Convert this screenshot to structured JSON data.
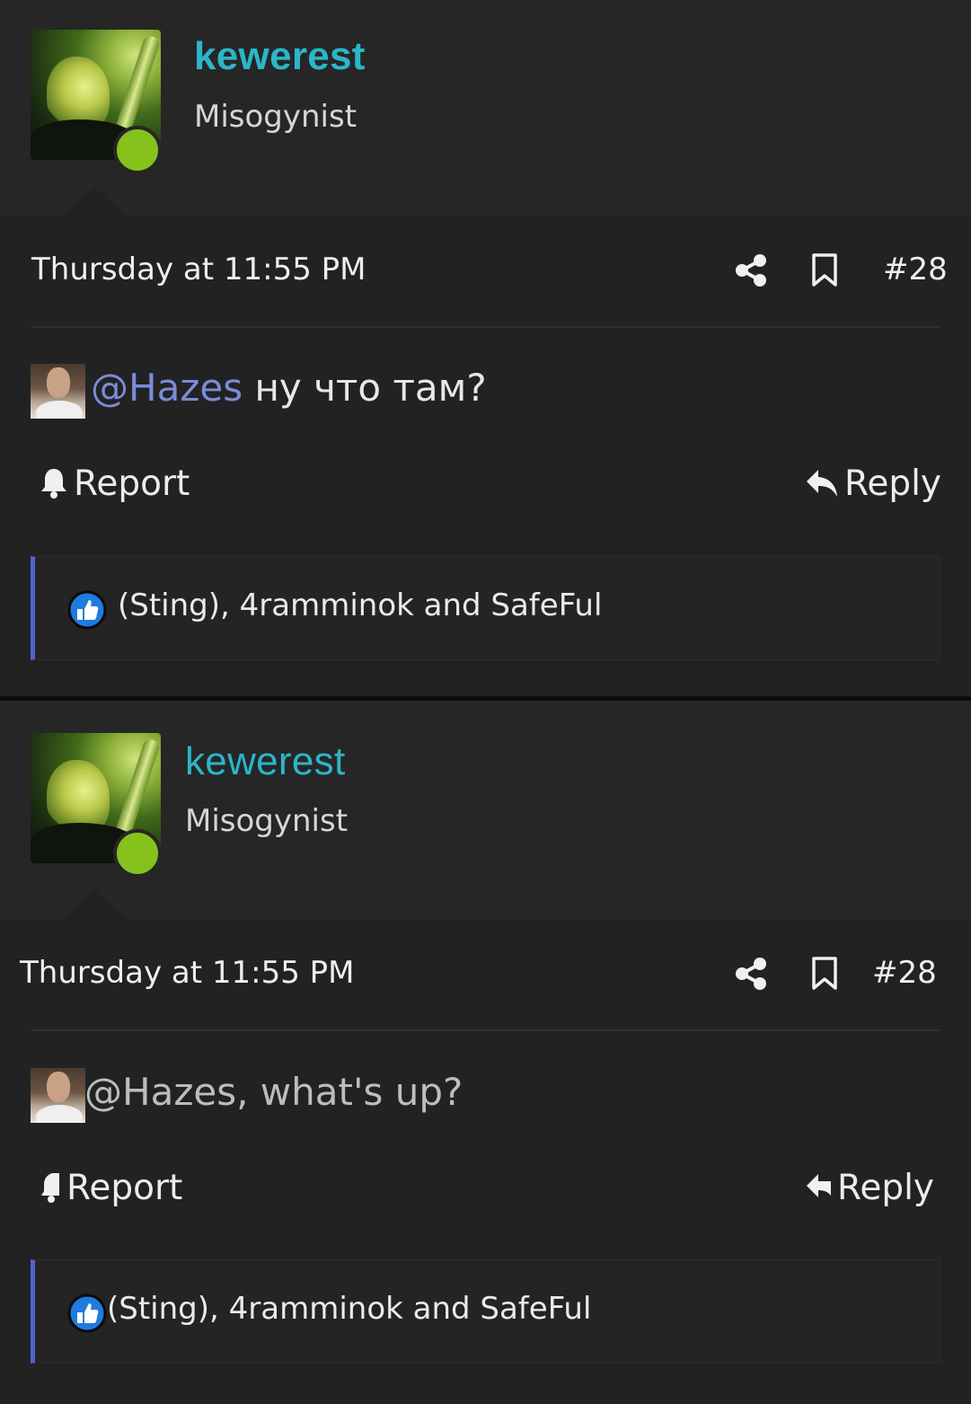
{
  "posts": [
    {
      "username": "kewerest",
      "user_title": "Misogynist",
      "date": "Thursday at 11:55 PM",
      "post_number": "#28",
      "mention": "@Hazes",
      "message_rest": " ну что там?",
      "report_label": "Report",
      "reply_label": "Reply",
      "reactions_text": "(Sting), 4ramminok and SafeFul"
    },
    {
      "username": "kewerest",
      "user_title": "Misogynist",
      "date": "Thursday at 11:55 PM",
      "post_number": "#28",
      "mention": "@Hazes",
      "message_rest": ", what's up?",
      "report_label": "Report",
      "reply_label": "Reply",
      "reactions_text": "(Sting), 4ramminok and SafeFul"
    }
  ],
  "icons": {
    "share": "share-icon",
    "bookmark": "bookmark-icon",
    "report": "bell-icon",
    "reply": "reply-arrow-icon",
    "like": "thumbs-up-icon"
  },
  "colors": {
    "username": "#2bb6c9",
    "mention": "#7b8ad9",
    "online": "#86c21c",
    "reaction_accent": "#5164c8",
    "background": "#262626"
  }
}
